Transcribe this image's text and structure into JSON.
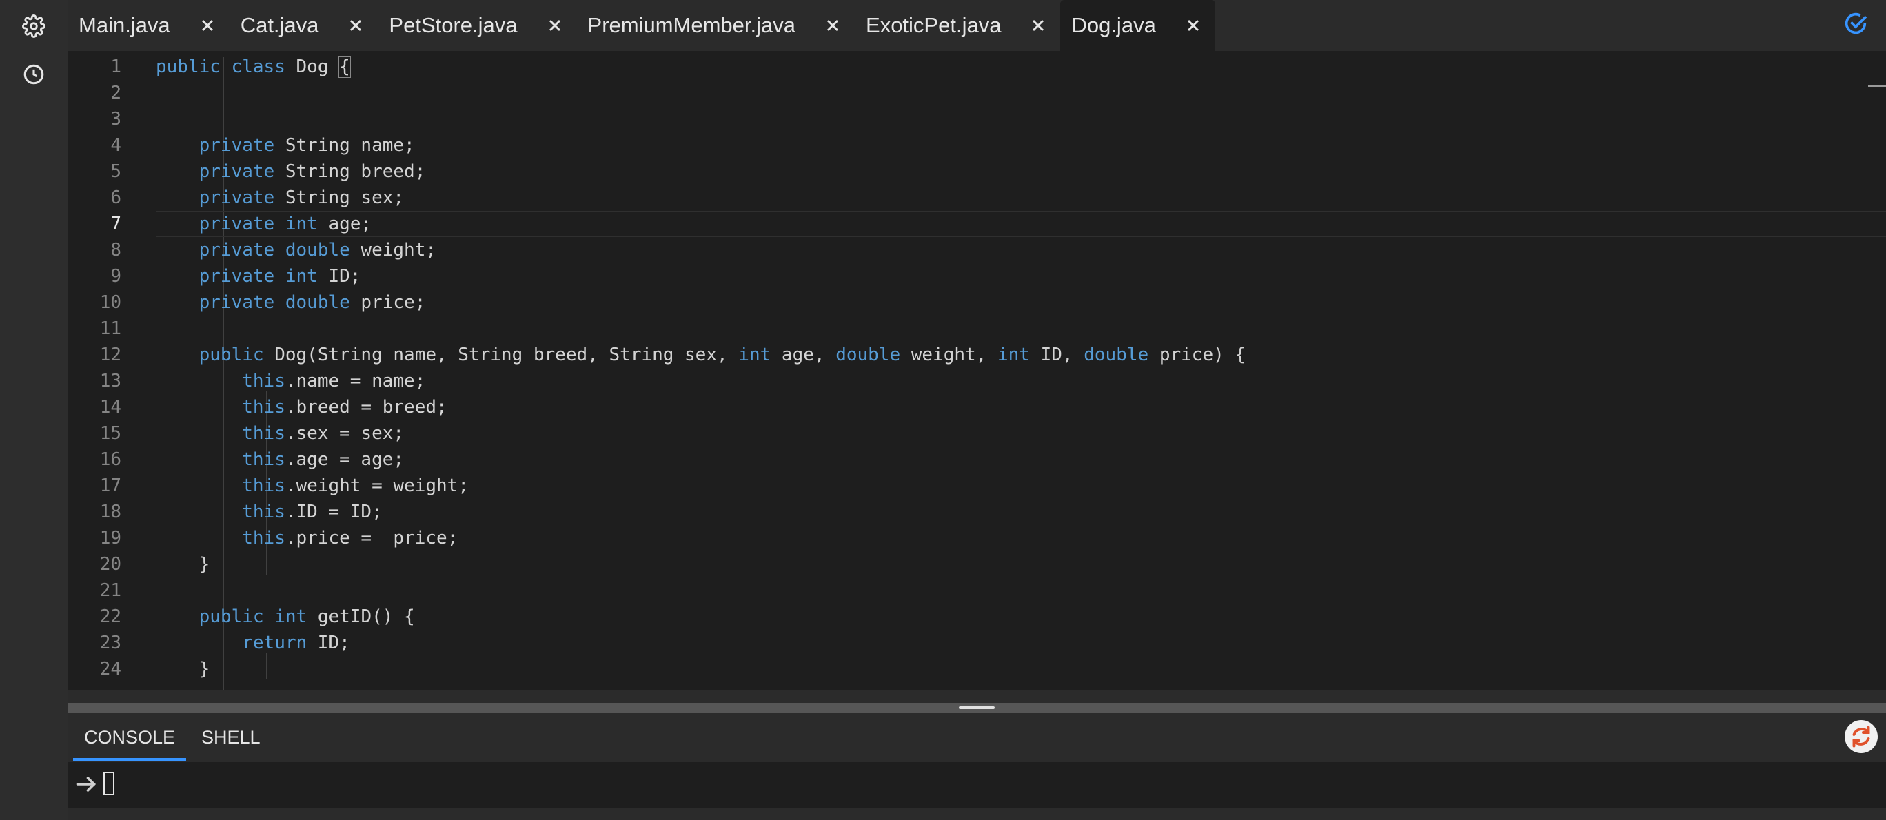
{
  "tabs": [
    {
      "label": "Main.java",
      "active": false
    },
    {
      "label": "Cat.java",
      "active": false
    },
    {
      "label": "PetStore.java",
      "active": false
    },
    {
      "label": "PremiumMember.java",
      "active": false
    },
    {
      "label": "ExoticPet.java",
      "active": false
    },
    {
      "label": "Dog.java",
      "active": true
    }
  ],
  "editor": {
    "current_line": 7,
    "lines": [
      "public class Dog {",
      "",
      "",
      "    private String name;",
      "    private String breed;",
      "    private String sex;",
      "    private int age;",
      "    private double weight;",
      "    private int ID;",
      "    private double price;",
      "",
      "    public Dog(String name, String breed, String sex, int age, double weight, int ID, double price) {",
      "        this.name = name;",
      "        this.breed = breed;",
      "        this.sex = sex;",
      "        this.age = age;",
      "        this.weight = weight;",
      "        this.ID = ID;",
      "        this.price =  price;",
      "    }",
      "",
      "    public int getID() {",
      "        return ID;",
      "    }"
    ]
  },
  "panel": {
    "tabs": [
      "CONSOLE",
      "SHELL"
    ],
    "active_tab": "CONSOLE"
  },
  "icons": {
    "settings": "gear-icon",
    "history": "clock-icon",
    "tab_close": "close-icon",
    "status": "check-circle-icon",
    "refresh": "refresh-icon",
    "prompt": "arrow-right-icon"
  },
  "colors": {
    "keyword": "#569cd6",
    "accent": "#3794ff",
    "refresh": "#e0522c"
  }
}
